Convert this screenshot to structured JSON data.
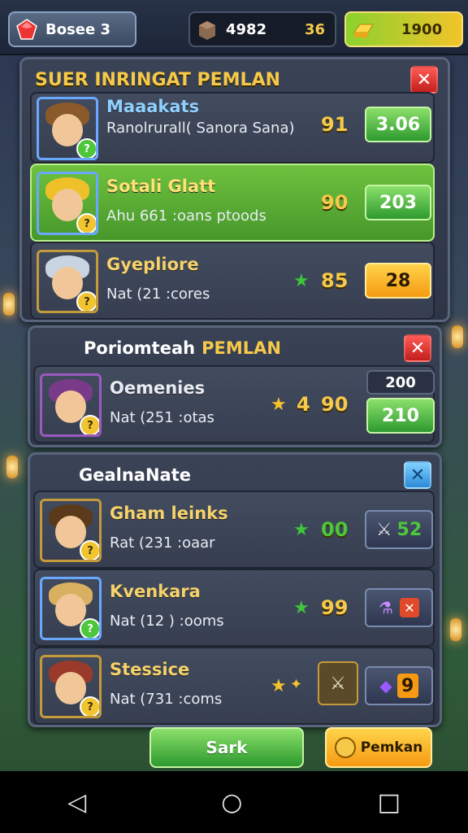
{
  "topbar": {
    "profile": {
      "icon": "red-gem-icon",
      "label": "Bosee 3"
    },
    "stone": {
      "icon": "stone-block-icon",
      "value": "4982",
      "value2": "36"
    },
    "gold": {
      "icon": "gold-bar-icon",
      "value": "1900"
    }
  },
  "panels": [
    {
      "title": "SUER INRINGAT PEMLAN",
      "close_icon": "close-icon",
      "rows": [
        {
          "name": "Maaakats",
          "sub": "Ranolrurall( Sanora Sana)",
          "score": "91",
          "button": "3.06",
          "top_tag": "",
          "hair": "#8a5a2a"
        },
        {
          "name": "Sotali Glatt",
          "sub": "Ahu 661 :oans ptoods",
          "score": "90",
          "button": "203",
          "highlighted": true,
          "hair": "#f0c02a"
        },
        {
          "name": "Gyepliore",
          "sub": "Nat (21 :cores",
          "score": "85",
          "button": "28",
          "hair": "#c9d4e2"
        }
      ]
    },
    {
      "title_a": "Poriomteah",
      "title_b": "PEMLAN",
      "rows": [
        {
          "name": "Oemenies",
          "sub": "Nat (251 :otas",
          "score_a": "4",
          "score_b": "90",
          "tag": "200",
          "button": "210",
          "hair": "#7a3a8a"
        }
      ]
    },
    {
      "title": "GealnaNate",
      "rows": [
        {
          "name": "Gham leinks",
          "sub": "Rat (231 :oaar",
          "score": "00",
          "button": "52",
          "hair": "#5a3a1a"
        },
        {
          "name": "Kvenkara",
          "sub": "Nat (12 ) :ooms",
          "score": "99",
          "hair": "#d8b060"
        },
        {
          "name": "Stessice",
          "sub": "Nat (731 :coms",
          "button": "9",
          "hair": "#9a3a2a"
        }
      ]
    }
  ],
  "footer": {
    "sort_label": "Sark",
    "premium_label": "Pemkan"
  },
  "nav": {
    "back": "◁",
    "home": "○",
    "recent": "□"
  }
}
